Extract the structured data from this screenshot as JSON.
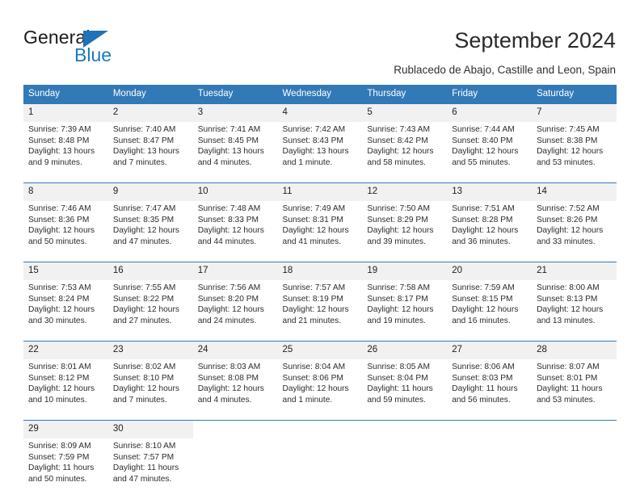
{
  "brand": {
    "name_top": "General",
    "name_bottom": "Blue",
    "triangle_color": "#1e72b8",
    "text_color": "#1b1b1b",
    "blue_color": "#1c7ac0"
  },
  "header": {
    "title": "September 2024",
    "subtitle": "Rublacedo de Abajo, Castille and Leon, Spain"
  },
  "calendar": {
    "accent_color": "#3279b8",
    "daynum_band_color": "#f1f1f1",
    "weekday_headers": [
      "Sunday",
      "Monday",
      "Tuesday",
      "Wednesday",
      "Thursday",
      "Friday",
      "Saturday"
    ],
    "weeks": [
      [
        {
          "day": "1",
          "sunrise": "Sunrise: 7:39 AM",
          "sunset": "Sunset: 8:48 PM",
          "daylight_line1": "Daylight: 13 hours",
          "daylight_line2": "and 9 minutes."
        },
        {
          "day": "2",
          "sunrise": "Sunrise: 7:40 AM",
          "sunset": "Sunset: 8:47 PM",
          "daylight_line1": "Daylight: 13 hours",
          "daylight_line2": "and 7 minutes."
        },
        {
          "day": "3",
          "sunrise": "Sunrise: 7:41 AM",
          "sunset": "Sunset: 8:45 PM",
          "daylight_line1": "Daylight: 13 hours",
          "daylight_line2": "and 4 minutes."
        },
        {
          "day": "4",
          "sunrise": "Sunrise: 7:42 AM",
          "sunset": "Sunset: 8:43 PM",
          "daylight_line1": "Daylight: 13 hours",
          "daylight_line2": "and 1 minute."
        },
        {
          "day": "5",
          "sunrise": "Sunrise: 7:43 AM",
          "sunset": "Sunset: 8:42 PM",
          "daylight_line1": "Daylight: 12 hours",
          "daylight_line2": "and 58 minutes."
        },
        {
          "day": "6",
          "sunrise": "Sunrise: 7:44 AM",
          "sunset": "Sunset: 8:40 PM",
          "daylight_line1": "Daylight: 12 hours",
          "daylight_line2": "and 55 minutes."
        },
        {
          "day": "7",
          "sunrise": "Sunrise: 7:45 AM",
          "sunset": "Sunset: 8:38 PM",
          "daylight_line1": "Daylight: 12 hours",
          "daylight_line2": "and 53 minutes."
        }
      ],
      [
        {
          "day": "8",
          "sunrise": "Sunrise: 7:46 AM",
          "sunset": "Sunset: 8:36 PM",
          "daylight_line1": "Daylight: 12 hours",
          "daylight_line2": "and 50 minutes."
        },
        {
          "day": "9",
          "sunrise": "Sunrise: 7:47 AM",
          "sunset": "Sunset: 8:35 PM",
          "daylight_line1": "Daylight: 12 hours",
          "daylight_line2": "and 47 minutes."
        },
        {
          "day": "10",
          "sunrise": "Sunrise: 7:48 AM",
          "sunset": "Sunset: 8:33 PM",
          "daylight_line1": "Daylight: 12 hours",
          "daylight_line2": "and 44 minutes."
        },
        {
          "day": "11",
          "sunrise": "Sunrise: 7:49 AM",
          "sunset": "Sunset: 8:31 PM",
          "daylight_line1": "Daylight: 12 hours",
          "daylight_line2": "and 41 minutes."
        },
        {
          "day": "12",
          "sunrise": "Sunrise: 7:50 AM",
          "sunset": "Sunset: 8:29 PM",
          "daylight_line1": "Daylight: 12 hours",
          "daylight_line2": "and 39 minutes."
        },
        {
          "day": "13",
          "sunrise": "Sunrise: 7:51 AM",
          "sunset": "Sunset: 8:28 PM",
          "daylight_line1": "Daylight: 12 hours",
          "daylight_line2": "and 36 minutes."
        },
        {
          "day": "14",
          "sunrise": "Sunrise: 7:52 AM",
          "sunset": "Sunset: 8:26 PM",
          "daylight_line1": "Daylight: 12 hours",
          "daylight_line2": "and 33 minutes."
        }
      ],
      [
        {
          "day": "15",
          "sunrise": "Sunrise: 7:53 AM",
          "sunset": "Sunset: 8:24 PM",
          "daylight_line1": "Daylight: 12 hours",
          "daylight_line2": "and 30 minutes."
        },
        {
          "day": "16",
          "sunrise": "Sunrise: 7:55 AM",
          "sunset": "Sunset: 8:22 PM",
          "daylight_line1": "Daylight: 12 hours",
          "daylight_line2": "and 27 minutes."
        },
        {
          "day": "17",
          "sunrise": "Sunrise: 7:56 AM",
          "sunset": "Sunset: 8:20 PM",
          "daylight_line1": "Daylight: 12 hours",
          "daylight_line2": "and 24 minutes."
        },
        {
          "day": "18",
          "sunrise": "Sunrise: 7:57 AM",
          "sunset": "Sunset: 8:19 PM",
          "daylight_line1": "Daylight: 12 hours",
          "daylight_line2": "and 21 minutes."
        },
        {
          "day": "19",
          "sunrise": "Sunrise: 7:58 AM",
          "sunset": "Sunset: 8:17 PM",
          "daylight_line1": "Daylight: 12 hours",
          "daylight_line2": "and 19 minutes."
        },
        {
          "day": "20",
          "sunrise": "Sunrise: 7:59 AM",
          "sunset": "Sunset: 8:15 PM",
          "daylight_line1": "Daylight: 12 hours",
          "daylight_line2": "and 16 minutes."
        },
        {
          "day": "21",
          "sunrise": "Sunrise: 8:00 AM",
          "sunset": "Sunset: 8:13 PM",
          "daylight_line1": "Daylight: 12 hours",
          "daylight_line2": "and 13 minutes."
        }
      ],
      [
        {
          "day": "22",
          "sunrise": "Sunrise: 8:01 AM",
          "sunset": "Sunset: 8:12 PM",
          "daylight_line1": "Daylight: 12 hours",
          "daylight_line2": "and 10 minutes."
        },
        {
          "day": "23",
          "sunrise": "Sunrise: 8:02 AM",
          "sunset": "Sunset: 8:10 PM",
          "daylight_line1": "Daylight: 12 hours",
          "daylight_line2": "and 7 minutes."
        },
        {
          "day": "24",
          "sunrise": "Sunrise: 8:03 AM",
          "sunset": "Sunset: 8:08 PM",
          "daylight_line1": "Daylight: 12 hours",
          "daylight_line2": "and 4 minutes."
        },
        {
          "day": "25",
          "sunrise": "Sunrise: 8:04 AM",
          "sunset": "Sunset: 8:06 PM",
          "daylight_line1": "Daylight: 12 hours",
          "daylight_line2": "and 1 minute."
        },
        {
          "day": "26",
          "sunrise": "Sunrise: 8:05 AM",
          "sunset": "Sunset: 8:04 PM",
          "daylight_line1": "Daylight: 11 hours",
          "daylight_line2": "and 59 minutes."
        },
        {
          "day": "27",
          "sunrise": "Sunrise: 8:06 AM",
          "sunset": "Sunset: 8:03 PM",
          "daylight_line1": "Daylight: 11 hours",
          "daylight_line2": "and 56 minutes."
        },
        {
          "day": "28",
          "sunrise": "Sunrise: 8:07 AM",
          "sunset": "Sunset: 8:01 PM",
          "daylight_line1": "Daylight: 11 hours",
          "daylight_line2": "and 53 minutes."
        }
      ],
      [
        {
          "day": "29",
          "sunrise": "Sunrise: 8:09 AM",
          "sunset": "Sunset: 7:59 PM",
          "daylight_line1": "Daylight: 11 hours",
          "daylight_line2": "and 50 minutes."
        },
        {
          "day": "30",
          "sunrise": "Sunrise: 8:10 AM",
          "sunset": "Sunset: 7:57 PM",
          "daylight_line1": "Daylight: 11 hours",
          "daylight_line2": "and 47 minutes."
        },
        {
          "day": "",
          "sunrise": "",
          "sunset": "",
          "daylight_line1": "",
          "daylight_line2": ""
        },
        {
          "day": "",
          "sunrise": "",
          "sunset": "",
          "daylight_line1": "",
          "daylight_line2": ""
        },
        {
          "day": "",
          "sunrise": "",
          "sunset": "",
          "daylight_line1": "",
          "daylight_line2": ""
        },
        {
          "day": "",
          "sunrise": "",
          "sunset": "",
          "daylight_line1": "",
          "daylight_line2": ""
        },
        {
          "day": "",
          "sunrise": "",
          "sunset": "",
          "daylight_line1": "",
          "daylight_line2": ""
        }
      ]
    ]
  }
}
